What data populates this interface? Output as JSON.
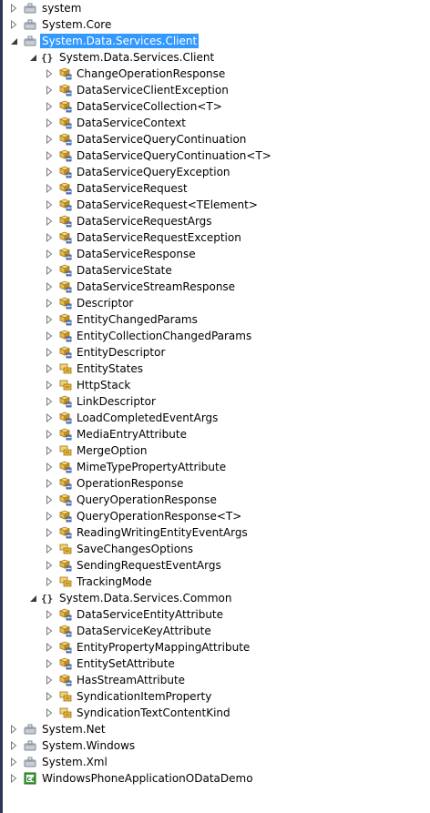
{
  "tree": {
    "selected_color": "#3399ff",
    "rows": [
      {
        "level": 0,
        "label": "system",
        "expander": "collapsed",
        "icon": "assembly-icon",
        "selected": false
      },
      {
        "level": 0,
        "label": "System.Core",
        "expander": "collapsed",
        "icon": "assembly-icon",
        "selected": false
      },
      {
        "level": 0,
        "label": "System.Data.Services.Client",
        "expander": "expanded",
        "icon": "assembly-icon",
        "selected": true
      },
      {
        "level": 1,
        "label": "System.Data.Services.Client",
        "expander": "expanded",
        "icon": "namespace-icon",
        "selected": false
      },
      {
        "level": 2,
        "label": "ChangeOperationResponse",
        "expander": "collapsed",
        "icon": "class-icon",
        "selected": false
      },
      {
        "level": 2,
        "label": "DataServiceClientException",
        "expander": "collapsed",
        "icon": "class-icon",
        "selected": false
      },
      {
        "level": 2,
        "label": "DataServiceCollection<T>",
        "expander": "collapsed",
        "icon": "class-icon",
        "selected": false
      },
      {
        "level": 2,
        "label": "DataServiceContext",
        "expander": "collapsed",
        "icon": "class-icon",
        "selected": false
      },
      {
        "level": 2,
        "label": "DataServiceQueryContinuation",
        "expander": "collapsed",
        "icon": "class-icon",
        "selected": false
      },
      {
        "level": 2,
        "label": "DataServiceQueryContinuation<T>",
        "expander": "collapsed",
        "icon": "class-icon",
        "selected": false
      },
      {
        "level": 2,
        "label": "DataServiceQueryException",
        "expander": "collapsed",
        "icon": "class-icon",
        "selected": false
      },
      {
        "level": 2,
        "label": "DataServiceRequest",
        "expander": "collapsed",
        "icon": "class-icon",
        "selected": false
      },
      {
        "level": 2,
        "label": "DataServiceRequest<TElement>",
        "expander": "collapsed",
        "icon": "class-icon",
        "selected": false
      },
      {
        "level": 2,
        "label": "DataServiceRequestArgs",
        "expander": "collapsed",
        "icon": "class-icon",
        "selected": false
      },
      {
        "level": 2,
        "label": "DataServiceRequestException",
        "expander": "collapsed",
        "icon": "class-icon",
        "selected": false
      },
      {
        "level": 2,
        "label": "DataServiceResponse",
        "expander": "collapsed",
        "icon": "class-icon",
        "selected": false
      },
      {
        "level": 2,
        "label": "DataServiceState",
        "expander": "collapsed",
        "icon": "class-icon",
        "selected": false
      },
      {
        "level": 2,
        "label": "DataServiceStreamResponse",
        "expander": "collapsed",
        "icon": "class-icon",
        "selected": false
      },
      {
        "level": 2,
        "label": "Descriptor",
        "expander": "collapsed",
        "icon": "class-icon",
        "selected": false
      },
      {
        "level": 2,
        "label": "EntityChangedParams",
        "expander": "collapsed",
        "icon": "class-icon",
        "selected": false
      },
      {
        "level": 2,
        "label": "EntityCollectionChangedParams",
        "expander": "collapsed",
        "icon": "class-icon",
        "selected": false
      },
      {
        "level": 2,
        "label": "EntityDescriptor",
        "expander": "collapsed",
        "icon": "class-icon",
        "selected": false
      },
      {
        "level": 2,
        "label": "EntityStates",
        "expander": "collapsed",
        "icon": "enum-icon",
        "selected": false
      },
      {
        "level": 2,
        "label": "HttpStack",
        "expander": "collapsed",
        "icon": "enum-icon",
        "selected": false
      },
      {
        "level": 2,
        "label": "LinkDescriptor",
        "expander": "collapsed",
        "icon": "class-icon",
        "selected": false
      },
      {
        "level": 2,
        "label": "LoadCompletedEventArgs",
        "expander": "collapsed",
        "icon": "class-icon",
        "selected": false
      },
      {
        "level": 2,
        "label": "MediaEntryAttribute",
        "expander": "collapsed",
        "icon": "class-icon",
        "selected": false
      },
      {
        "level": 2,
        "label": "MergeOption",
        "expander": "collapsed",
        "icon": "enum-icon",
        "selected": false
      },
      {
        "level": 2,
        "label": "MimeTypePropertyAttribute",
        "expander": "collapsed",
        "icon": "class-icon",
        "selected": false
      },
      {
        "level": 2,
        "label": "OperationResponse",
        "expander": "collapsed",
        "icon": "class-icon",
        "selected": false
      },
      {
        "level": 2,
        "label": "QueryOperationResponse",
        "expander": "collapsed",
        "icon": "class-icon",
        "selected": false
      },
      {
        "level": 2,
        "label": "QueryOperationResponse<T>",
        "expander": "collapsed",
        "icon": "class-icon",
        "selected": false
      },
      {
        "level": 2,
        "label": "ReadingWritingEntityEventArgs",
        "expander": "collapsed",
        "icon": "class-icon",
        "selected": false
      },
      {
        "level": 2,
        "label": "SaveChangesOptions",
        "expander": "collapsed",
        "icon": "enum-icon",
        "selected": false
      },
      {
        "level": 2,
        "label": "SendingRequestEventArgs",
        "expander": "collapsed",
        "icon": "class-icon",
        "selected": false
      },
      {
        "level": 2,
        "label": "TrackingMode",
        "expander": "collapsed",
        "icon": "enum-icon",
        "selected": false
      },
      {
        "level": 1,
        "label": "System.Data.Services.Common",
        "expander": "expanded",
        "icon": "namespace-icon",
        "selected": false
      },
      {
        "level": 2,
        "label": "DataServiceEntityAttribute",
        "expander": "collapsed",
        "icon": "class-icon",
        "selected": false
      },
      {
        "level": 2,
        "label": "DataServiceKeyAttribute",
        "expander": "collapsed",
        "icon": "class-icon",
        "selected": false
      },
      {
        "level": 2,
        "label": "EntityPropertyMappingAttribute",
        "expander": "collapsed",
        "icon": "class-icon",
        "selected": false
      },
      {
        "level": 2,
        "label": "EntitySetAttribute",
        "expander": "collapsed",
        "icon": "class-icon",
        "selected": false
      },
      {
        "level": 2,
        "label": "HasStreamAttribute",
        "expander": "collapsed",
        "icon": "class-icon",
        "selected": false
      },
      {
        "level": 2,
        "label": "SyndicationItemProperty",
        "expander": "collapsed",
        "icon": "enum-icon",
        "selected": false
      },
      {
        "level": 2,
        "label": "SyndicationTextContentKind",
        "expander": "collapsed",
        "icon": "enum-icon",
        "selected": false
      },
      {
        "level": 0,
        "label": "System.Net",
        "expander": "collapsed",
        "icon": "assembly-icon",
        "selected": false
      },
      {
        "level": 0,
        "label": "System.Windows",
        "expander": "collapsed",
        "icon": "assembly-icon",
        "selected": false
      },
      {
        "level": 0,
        "label": "System.Xml",
        "expander": "collapsed",
        "icon": "assembly-icon",
        "selected": false
      },
      {
        "level": 0,
        "label": "WindowsPhoneApplicationODataDemo",
        "expander": "collapsed",
        "icon": "project-icon",
        "selected": false
      }
    ]
  }
}
